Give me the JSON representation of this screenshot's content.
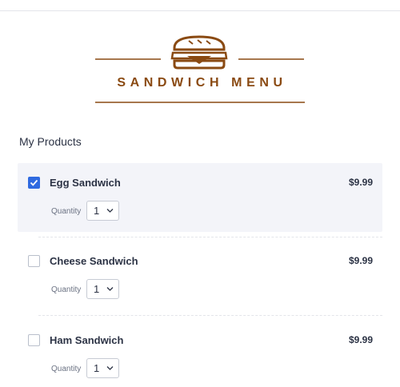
{
  "header": {
    "title": "SANDWICH MENU",
    "logo_icon": "sandwich-icon",
    "brand_color": "#8a4a12"
  },
  "section": {
    "title": "My Products"
  },
  "products": [
    {
      "name": "Egg Sandwich",
      "price": "$9.99",
      "selected": true,
      "quantity_label": "Quantity",
      "quantity": "1"
    },
    {
      "name": "Cheese Sandwich",
      "price": "$9.99",
      "selected": false,
      "quantity_label": "Quantity",
      "quantity": "1"
    },
    {
      "name": "Ham Sandwich",
      "price": "$9.99",
      "selected": false,
      "quantity_label": "Quantity",
      "quantity": "1"
    }
  ],
  "colors": {
    "accent": "#2f6ae0",
    "selected_row": "#f3f4f9"
  }
}
